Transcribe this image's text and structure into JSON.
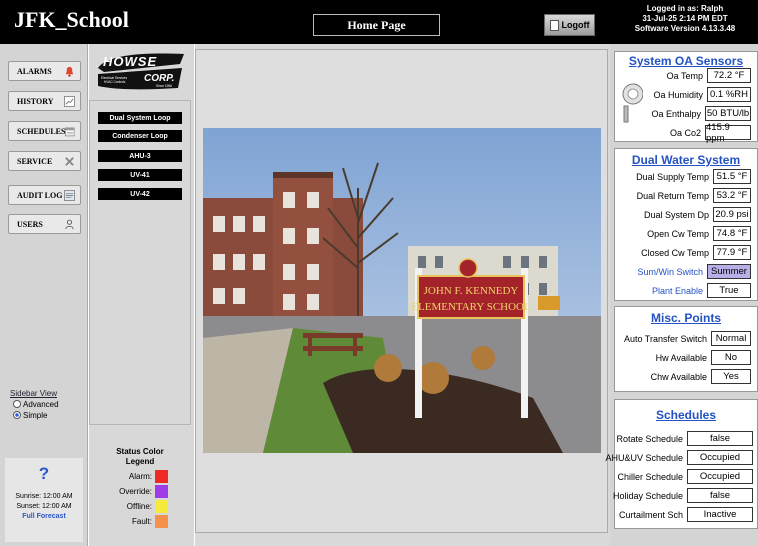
{
  "header": {
    "app_title": "JFK_School",
    "home_button": "Home Page",
    "logoff_button": "Logoff",
    "login_line": "Logged in as: Ralph",
    "datetime_line": "31-Jul-25 2:14 PM EDT",
    "version_line": "Software Version 4.13.3.48"
  },
  "nav": {
    "items": [
      {
        "label": "ALARMS",
        "icon": "bell-icon"
      },
      {
        "label": "HISTORY",
        "icon": "chart-icon"
      },
      {
        "label": "SCHEDULES",
        "icon": "calendar-icon"
      },
      {
        "label": "SERVICE",
        "icon": "tools-icon"
      },
      {
        "label": "AUDIT LOG",
        "icon": "log-icon"
      },
      {
        "label": "USERS",
        "icon": "user-icon"
      }
    ]
  },
  "sidebar_view": {
    "title": "Sidebar View",
    "options": [
      "Advanced",
      "Simple"
    ],
    "selected": "Simple"
  },
  "weather": {
    "icon": "question-icon",
    "sunrise": "Sunrise: 12:00 AM",
    "sunset": "Sunset: 12:00 AM",
    "forecast_link": "Full Forecast"
  },
  "logo": {
    "text": "HOWSE CORP.",
    "sub": "Electrical Services  HVAC Controls  Since 1956"
  },
  "systems": [
    "Dual System Loop",
    "Condenser Loop",
    "AHU-3",
    "UV-41",
    "UV-42"
  ],
  "legend": {
    "title_line1": "Status Color",
    "title_line2": "Legend",
    "items": [
      {
        "label": "Alarm:",
        "color": "#ee2a24"
      },
      {
        "label": "Override:",
        "color": "#a03ce6"
      },
      {
        "label": "Offline:",
        "color": "#f6ea3a"
      },
      {
        "label": "Fault:",
        "color": "#f5914a"
      }
    ]
  },
  "photo": {
    "sign_line1": "JOHN F. KENNEDY",
    "sign_line2": "ELEMENTARY SCHOOL"
  },
  "oa_sensors": {
    "title": "System OA Sensors",
    "icon": "sensor-icon",
    "rows": [
      {
        "label": "Oa Temp",
        "value": "72.2 °F"
      },
      {
        "label": "Oa Humidity",
        "value": "0.1 %RH"
      },
      {
        "label": "Oa Enthalpy",
        "value": "50 BTU/lb"
      },
      {
        "label": "Oa Co2",
        "value": "415.9 ppm"
      }
    ]
  },
  "dual_water": {
    "title": "Dual Water System",
    "rows": [
      {
        "label": "Dual Supply Temp",
        "value": "51.5 °F"
      },
      {
        "label": "Dual Return Temp",
        "value": "53.2 °F"
      },
      {
        "label": "Dual System Dp",
        "value": "20.9 psi"
      },
      {
        "label": "Open Cw Temp",
        "value": "74.8 °F"
      },
      {
        "label": "Closed Cw Temp",
        "value": "77.9 °F"
      },
      {
        "label": "Sum/Win Switch",
        "value": "Summer"
      },
      {
        "label": "Plant Enable",
        "value": "True"
      }
    ]
  },
  "misc": {
    "title": "Misc. Points",
    "rows": [
      {
        "label": "Auto Transfer Switch",
        "value": "Normal"
      },
      {
        "label": "Hw Available",
        "value": "No"
      },
      {
        "label": "Chw Available",
        "value": "Yes"
      }
    ]
  },
  "schedules": {
    "title": "Schedules",
    "rows": [
      {
        "label": "Rotate Schedule",
        "value": "false"
      },
      {
        "label": "AHU&UV Schedule",
        "value": "Occupied"
      },
      {
        "label": "Chiller Schedule",
        "value": "Occupied"
      },
      {
        "label": "Holiday Schedule",
        "value": "false"
      },
      {
        "label": "Curtailment Sch",
        "value": "Inactive"
      }
    ]
  },
  "colors": {
    "link_blue": "#2452c2",
    "override_fill": "#b9aee8"
  }
}
